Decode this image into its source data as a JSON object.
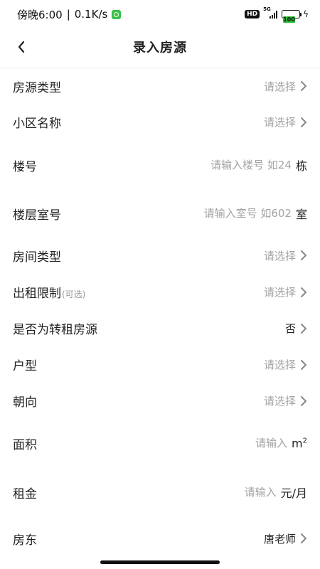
{
  "status_bar": {
    "time": "傍晚6:00",
    "speed": "0.1K/s",
    "hd": "HD",
    "network": "5G",
    "battery": "100"
  },
  "nav": {
    "title": "录入房源"
  },
  "form": {
    "property_type": {
      "label": "房源类型",
      "placeholder": "请选择"
    },
    "community": {
      "label": "小区名称",
      "placeholder": "请选择"
    },
    "building": {
      "label": "楼号",
      "placeholder": "请输入楼号 如24",
      "unit": "栋"
    },
    "room": {
      "label": "楼层室号",
      "placeholder": "请输入室号 如602",
      "unit": "室"
    },
    "room_type": {
      "label": "房间类型",
      "placeholder": "请选择"
    },
    "rent_limit": {
      "label": "出租限制",
      "optional": "(可选)",
      "placeholder": "请选择"
    },
    "sublet": {
      "label": "是否为转租房源",
      "value": "否"
    },
    "layout": {
      "label": "户型",
      "placeholder": "请选择"
    },
    "orientation": {
      "label": "朝向",
      "placeholder": "请选择"
    },
    "area": {
      "label": "面积",
      "placeholder": "请输入",
      "unit": "m",
      "unit_sup": "2"
    },
    "rent": {
      "label": "租金",
      "placeholder": "请输入",
      "unit": "元/月"
    },
    "landlord": {
      "label": "房东",
      "value": "唐老师"
    }
  }
}
